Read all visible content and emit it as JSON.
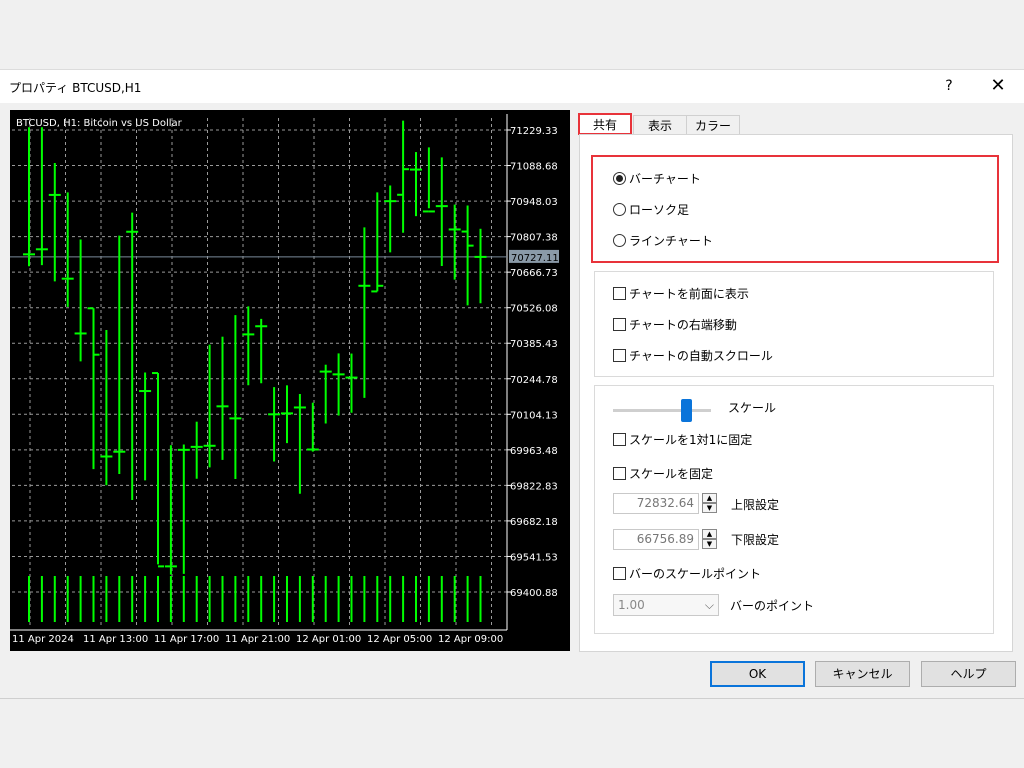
{
  "window": {
    "title": "プロパティ BTCUSD,H1",
    "help": "?",
    "close": "✕"
  },
  "tabs": [
    {
      "label": "共有",
      "active": true
    },
    {
      "label": "表示",
      "active": false
    },
    {
      "label": "カラー",
      "active": false
    }
  ],
  "chart_type_group": {
    "options": [
      {
        "label": "バーチャート",
        "selected": true
      },
      {
        "label": "ローソク足",
        "selected": false
      },
      {
        "label": "ラインチャート",
        "selected": false
      }
    ]
  },
  "chart_options": [
    {
      "label": "チャートを前面に表示",
      "checked": false
    },
    {
      "label": "チャートの右端移動",
      "checked": false
    },
    {
      "label": "チャートの自動スクロール",
      "checked": false
    }
  ],
  "scale": {
    "label": "スケール",
    "fix_1to1": {
      "label": "スケールを1対1に固定",
      "checked": false
    },
    "fix_scale": {
      "label": "スケールを固定",
      "checked": false
    },
    "upper": {
      "value": "72832.64",
      "label": "上限設定"
    },
    "lower": {
      "value": "66756.89",
      "label": "下限設定"
    },
    "bar_scale_point": {
      "label": "バーのスケールポイント",
      "checked": false
    },
    "bar_point": {
      "value": "1.00",
      "label": "バーのポイント"
    }
  },
  "buttons": {
    "ok": "OK",
    "cancel": "キャンセル",
    "help": "ヘルプ"
  },
  "colors": {
    "accent": "#0a74da",
    "highlight": "#e8333a",
    "bar": "#00ff00",
    "chart_bg": "#000000"
  },
  "chart_data": {
    "type": "bar",
    "title": "BTCUSD, H1: Bitcoin vs US Dollar",
    "y_ticks": [
      "71229.33",
      "71088.68",
      "70948.03",
      "70807.38",
      "70666.73",
      "70526.08",
      "70385.43",
      "70244.78",
      "70104.13",
      "69963.48",
      "69822.83",
      "69682.18",
      "69541.53",
      "69400.88"
    ],
    "current_price": "70727.11",
    "x_ticks": [
      "11 Apr 2024",
      "11 Apr 13:00",
      "11 Apr 17:00",
      "11 Apr 21:00",
      "12 Apr 01:00",
      "12 Apr 05:00",
      "12 Apr 09:00"
    ],
    "ylim": [
      69400.88,
      71229.33
    ],
    "ohlc": [
      {
        "o": 70737.3,
        "h": 71240.0,
        "l": 70690.0,
        "c": 70737.3
      },
      {
        "o": 70757.2,
        "h": 71240.0,
        "l": 70694.5,
        "c": 70757.2
      },
      {
        "o": 70972.4,
        "h": 71098.8,
        "l": 70630.0,
        "c": 70972.4
      },
      {
        "o": 70640.9,
        "h": 70982.4,
        "l": 70529.4,
        "c": 70640.9
      },
      {
        "o": 70424.1,
        "h": 70796.1,
        "l": 70313.8,
        "c": 70424.1
      },
      {
        "o": 70523.7,
        "h": 70523.7,
        "l": 69887.2,
        "c": 70340.1
      },
      {
        "o": 69937.1,
        "h": 70437.8,
        "l": 69823.4,
        "c": 69937.1
      },
      {
        "o": 69956.1,
        "h": 70811.1,
        "l": 69867.7,
        "c": 69956.1
      },
      {
        "o": 70826.6,
        "h": 70902.4,
        "l": 69764.8,
        "c": 70826.6
      },
      {
        "o": 70196.2,
        "h": 70269.7,
        "l": 69842.8,
        "c": 70196.2
      },
      {
        "o": 70267.4,
        "h": 70267.4,
        "l": 69510.3,
        "c": 69502.3
      },
      {
        "o": 69502.3,
        "h": 69981.5,
        "l": 69469.5,
        "c": 69502.3
      },
      {
        "o": 69963.5,
        "h": 69984.7,
        "l": 69472.7,
        "c": 69963.5
      },
      {
        "o": 69975.3,
        "h": 70074.9,
        "l": 69849.1,
        "c": 69975.3
      },
      {
        "o": 69979.6,
        "h": 70379.7,
        "l": 69894.2,
        "c": 69979.6
      },
      {
        "o": 70135.7,
        "h": 70411.3,
        "l": 69923.7,
        "c": 70135.7
      },
      {
        "o": 70088.0,
        "h": 70496.7,
        "l": 69848.2,
        "c": 70088.0
      },
      {
        "o": 70420.4,
        "h": 70531.1,
        "l": 70219.3,
        "c": 70420.4
      },
      {
        "o": 70452.6,
        "h": 70481.7,
        "l": 70227.1,
        "c": 70452.6
      },
      {
        "o": 70104.1,
        "h": 70211.7,
        "l": 69917.3,
        "c": 70104.1
      },
      {
        "o": 70107.8,
        "h": 70218.8,
        "l": 69990.1,
        "c": 70107.8
      },
      {
        "o": 70131.2,
        "h": 70184.5,
        "l": 69789.6,
        "c": 70131.2
      },
      {
        "o": 69964.8,
        "h": 70150.1,
        "l": 69956.5,
        "c": 69964.8
      },
      {
        "o": 70273.2,
        "h": 70300.5,
        "l": 70067.7,
        "c": 70273.2
      },
      {
        "o": 70262.2,
        "h": 70345.2,
        "l": 70099.3,
        "c": 70262.2
      },
      {
        "o": 70249.5,
        "h": 70344.6,
        "l": 70110.2,
        "c": 70249.5
      },
      {
        "o": 70612.8,
        "h": 70843.9,
        "l": 70169.4,
        "c": 70612.8
      },
      {
        "o": 70590.5,
        "h": 70982.4,
        "l": 70590.5,
        "c": 70612.8
      },
      {
        "o": 70947.7,
        "h": 71009.9,
        "l": 70745.0,
        "c": 70947.7
      },
      {
        "o": 70973.0,
        "h": 71266.3,
        "l": 70822.7,
        "c": 71074.2
      },
      {
        "o": 71072.7,
        "h": 71142.0,
        "l": 70888.4,
        "c": 71072.7
      },
      {
        "o": 70907.0,
        "h": 71160.5,
        "l": 70919.6,
        "c": 70907.0
      },
      {
        "o": 70928.0,
        "h": 71121.0,
        "l": 70691.2,
        "c": 70928.0
      },
      {
        "o": 70835.8,
        "h": 70933.9,
        "l": 70637.1,
        "c": 70835.8
      },
      {
        "o": 70827.4,
        "h": 70930.5,
        "l": 70535.3,
        "c": 70771.7
      },
      {
        "o": 70727.1,
        "h": 70838.4,
        "l": 70543.6,
        "c": 70727.1
      }
    ]
  }
}
